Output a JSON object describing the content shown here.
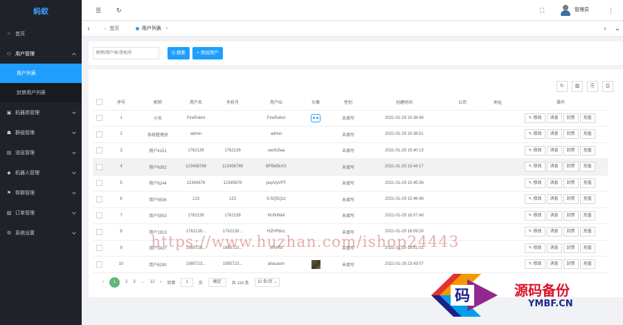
{
  "sidebar": {
    "logo": "蚂蚁",
    "items": [
      {
        "label": "首页",
        "icon": "home-icon",
        "glyph": "⌂"
      },
      {
        "label": "用户管理",
        "icon": "user-icon",
        "glyph": "⚇",
        "open": true,
        "children": [
          {
            "label": "用户列表",
            "active": true
          },
          {
            "label": "封禁用户列表",
            "active": false
          }
        ]
      },
      {
        "label": "机器类管理",
        "icon": "robot-icon",
        "glyph": "▣"
      },
      {
        "label": "群组管理",
        "icon": "group-icon",
        "glyph": "☗"
      },
      {
        "label": "消息管理",
        "icon": "message-icon",
        "glyph": "▤"
      },
      {
        "label": "机器人管理",
        "icon": "bot-icon",
        "glyph": "◆"
      },
      {
        "label": "帮群管理",
        "icon": "flag-icon",
        "glyph": "⚑"
      },
      {
        "label": "订单管理",
        "icon": "order-icon",
        "glyph": "▧"
      },
      {
        "label": "系统设置",
        "icon": "gear-icon",
        "glyph": "⚙"
      }
    ]
  },
  "header": {
    "menu_glyph": "☰",
    "refresh_glyph": "↻",
    "fullscreen_glyph": "⛶",
    "more_glyph": "⋮",
    "admin_name": "管理员"
  },
  "tabs": {
    "left_arrow": "‹",
    "right_arrow": "›",
    "home_label": "首页",
    "current_label": "用户列表",
    "close_glyph": "×",
    "down_arrow": "⌄"
  },
  "search": {
    "placeholder": "昵称/用户名/手机号",
    "search_label": "Q 搜索",
    "add_label": "+ 添加用户"
  },
  "toolbar": {
    "refresh_glyph": "↻",
    "columns_glyph": "▥",
    "export_glyph": "⎘",
    "print_glyph": "⎙"
  },
  "table": {
    "headers": [
      "",
      "序号",
      "昵称",
      "用户名",
      "手机号",
      "用户ID",
      "头像",
      "性别",
      "创建时间",
      "公司",
      "地址",
      "操作"
    ],
    "rows": [
      {
        "no": "1",
        "nick": "小天",
        "user": "FireRobot",
        "phone": "",
        "uid": "FireRobot",
        "avatar": "robot",
        "sex": "未填写",
        "time": "2021-01-29 15:38:48",
        "company": "",
        "addr": ""
      },
      {
        "no": "2",
        "nick": "系统管理员",
        "user": "admin",
        "phone": "",
        "uid": "admin",
        "avatar": "",
        "sex": "未填写",
        "time": "2021-01-29 15:38:51",
        "company": "",
        "addr": ""
      },
      {
        "no": "3",
        "nick": "用户4151",
        "user": "1762139",
        "phone": "1762139",
        "uid": "ueofu5aa",
        "avatar": "",
        "sex": "未填写",
        "time": "2021-01-29 15:40:13",
        "company": "",
        "addr": ""
      },
      {
        "no": "4",
        "nick": "用户6392",
        "user": "123456789",
        "phone": "123456789",
        "uid": "BFBkBkXX",
        "avatar": "",
        "sex": "未填写",
        "time": "2021-01-29 15:44:17",
        "company": "",
        "addr": ""
      },
      {
        "no": "5",
        "nick": "用户8244",
        "user": "12345678",
        "phone": "12345678",
        "uid": "pupVpVFF",
        "avatar": "",
        "sex": "未填写",
        "time": "2021-01-29 15:45:36",
        "company": "",
        "addr": ""
      },
      {
        "no": "6",
        "nick": "用户9536",
        "user": "123",
        "phone": "123",
        "uid": "S-5Q5Qzz",
        "avatar": "",
        "sex": "未填写",
        "time": "2021-01-29 15:46:48",
        "company": "",
        "addr": ""
      },
      {
        "no": "7",
        "nick": "用户5553",
        "user": "1762139",
        "phone": "1762139",
        "uid": "NUNINkk",
        "avatar": "",
        "sex": "未填写",
        "time": "2021-01-29 16:07:48",
        "company": "",
        "addr": ""
      },
      {
        "no": "8",
        "nick": "用户1913",
        "user": "1762139...",
        "phone": "1762139...",
        "uid": "HZHR8cc",
        "avatar": "",
        "sex": "未填写",
        "time": "2021-01-29 16:09:28",
        "company": "",
        "addr": ""
      },
      {
        "no": "9",
        "nick": "用户3427",
        "user": "1985723...",
        "phone": "1985723...",
        "uid": "xRxRd",
        "avatar": "",
        "sex": "未填写",
        "time": "2021-01-29 18:51:01",
        "company": "",
        "addr": ""
      },
      {
        "no": "10",
        "nick": "用户6290",
        "user": "1985723...",
        "phone": "1985723...",
        "uid": "aliauaum",
        "avatar": "photo",
        "sex": "未填写",
        "time": "2021-01-29 23:43:07",
        "company": "",
        "addr": ""
      }
    ],
    "ops": {
      "edit": "修改",
      "message": "消息",
      "ban": "封禁",
      "recharge": "充值",
      "pen": "✎"
    }
  },
  "pager": {
    "prev": "‹",
    "pages": [
      "1",
      "2",
      "3",
      "...",
      "12"
    ],
    "next": "›",
    "goto_label": "到第",
    "goto_value": "1",
    "page_unit": "页",
    "confirm": "确定",
    "total": "共 114 条",
    "page_size": "10 条/页"
  },
  "watermark": {
    "url": "https://www.huzhan.com/ishop24443",
    "brand_cn": "源码备份",
    "brand_en": "YMBF.CN",
    "badge_char": "码"
  },
  "colors": {
    "primary": "#1e9fff",
    "sidebar_bg": "#20222a",
    "pager_active": "#5fb878"
  }
}
